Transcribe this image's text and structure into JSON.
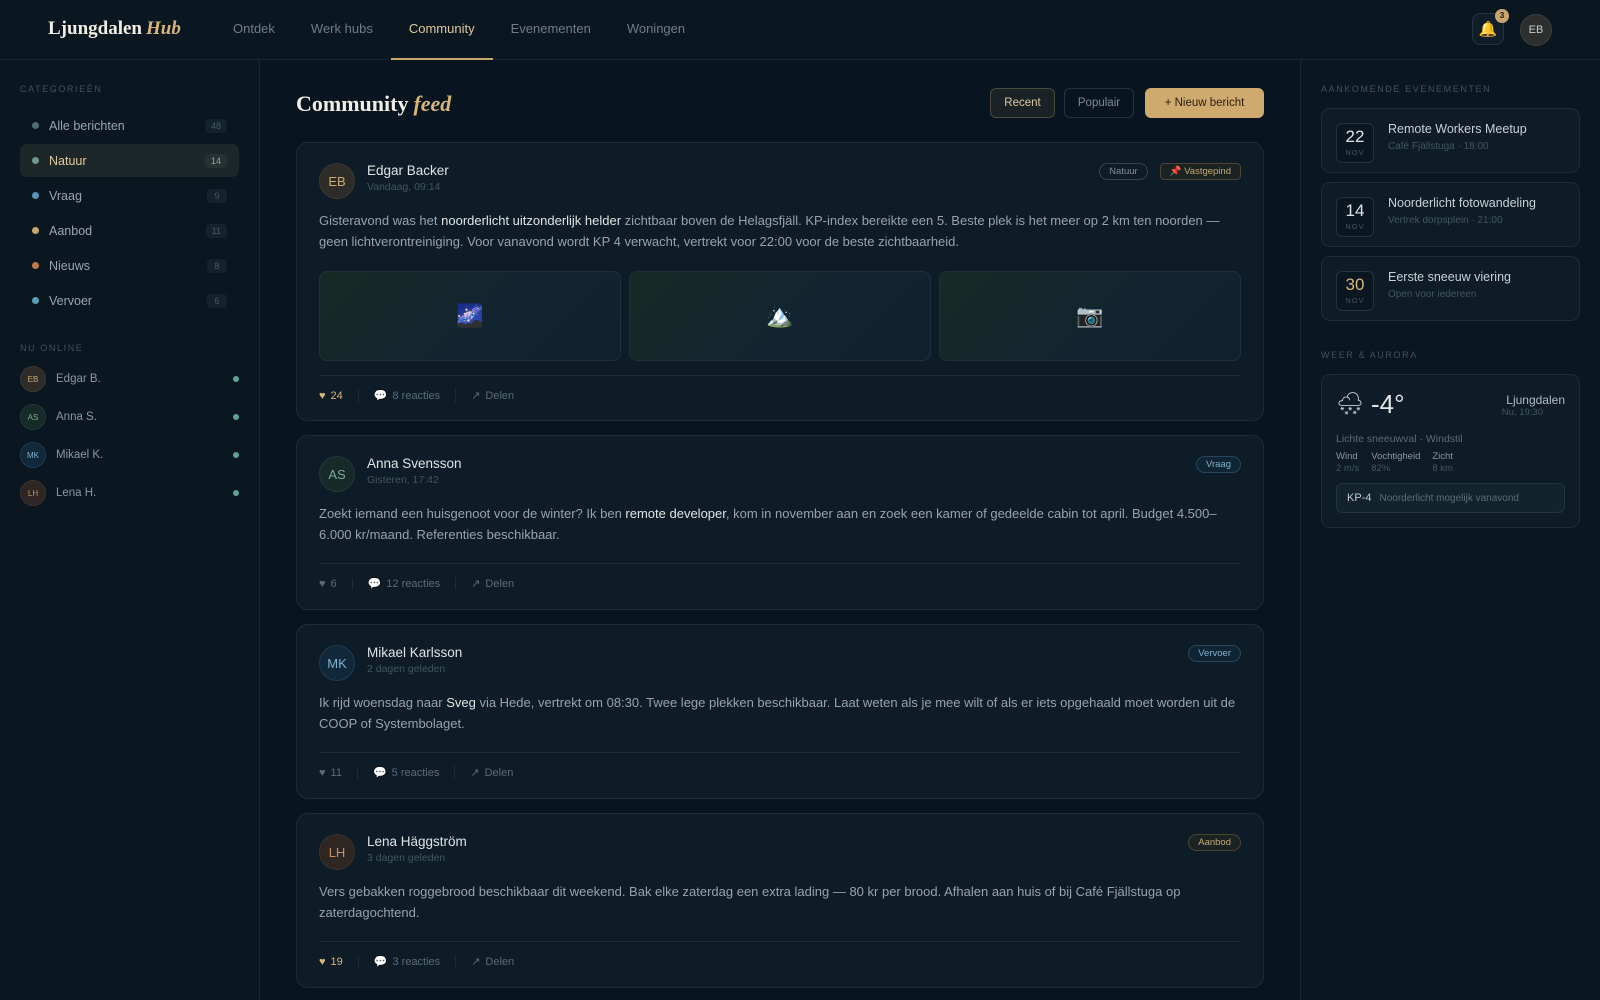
{
  "app": {
    "logo_main": "Ljungdalen",
    "logo_accent": "Hub"
  },
  "nav": [
    {
      "label": "Ontdek",
      "active": false
    },
    {
      "label": "Werk hubs",
      "active": false
    },
    {
      "label": "Community",
      "active": true
    },
    {
      "label": "Evenementen",
      "active": false
    },
    {
      "label": "Woningen",
      "active": false
    }
  ],
  "header": {
    "notification_count": "3",
    "user_initials": "EB"
  },
  "sidebar": {
    "categories_title": "CATEGORIEËN",
    "categories": [
      {
        "label": "Alle berichten",
        "count": "48",
        "color": "#4f6c72",
        "active": false
      },
      {
        "label": "Natuur",
        "count": "14",
        "color": "#6e9a8b",
        "active": true
      },
      {
        "label": "Vraag",
        "count": "9",
        "color": "#5a93b8",
        "active": false
      },
      {
        "label": "Aanbod",
        "count": "11",
        "color": "#c9a66b",
        "active": false
      },
      {
        "label": "Nieuws",
        "count": "8",
        "color": "#c07a4a",
        "active": false
      },
      {
        "label": "Vervoer",
        "count": "6",
        "color": "#5aa0b8",
        "active": false
      }
    ],
    "online_title": "NU ONLINE",
    "online": [
      {
        "initials": "EB",
        "name": "Edgar B."
      },
      {
        "initials": "AS",
        "name": "Anna S."
      },
      {
        "initials": "MK",
        "name": "Mikael K."
      },
      {
        "initials": "LH",
        "name": "Lena H."
      }
    ]
  },
  "feed": {
    "title": "Community",
    "title_accent": "feed",
    "buttons": {
      "recent": "Recent",
      "popular": "Populair",
      "new_post": "+ Nieuw bericht"
    },
    "posts": [
      {
        "initials": "EB",
        "author": "Edgar Backer",
        "time": "Vandaag, 09:14",
        "tags": [
          "Natuur"
        ],
        "pinned": "📌 Vastgepind",
        "body": [
          {
            "t": "Gisteravond was het "
          },
          {
            "t": "noorderlicht uitzonderlijk helder",
            "b": true
          },
          {
            "t": " zichtbaar boven de Helagsfjäll. KP-index bereikte een 5. Beste plek is het meer op 2 km ten noorden — geen lichtverontreiniging. Voor vanavond wordt KP 4 verwacht, vertrekt voor 22:00 voor de beste zichtbaarheid."
          }
        ],
        "images": [
          "🌌",
          "🏔️",
          "📷"
        ],
        "likes": "24",
        "comments": "8 reacties",
        "share": "Delen"
      },
      {
        "initials": "AS",
        "author": "Anna Svensson",
        "time": "Gisteren, 17:42",
        "tags": [
          "Vraag"
        ],
        "body": [
          {
            "t": "Zoekt iemand een huisgenoot voor de winter? Ik ben "
          },
          {
            "t": "remote developer",
            "b": true
          },
          {
            "t": ", kom in november aan en zoek een kamer of gedeelde cabin tot april. Budget 4.500–6.000 kr/maand. Referenties beschikbaar."
          }
        ],
        "likes": "6",
        "comments": "12 reacties",
        "share": "Delen"
      },
      {
        "initials": "MK",
        "author": "Mikael Karlsson",
        "time": "2 dagen geleden",
        "tags": [
          "Vervoer"
        ],
        "body": [
          {
            "t": "Ik rijd woensdag naar "
          },
          {
            "t": "Sveg",
            "b": true
          },
          {
            "t": " via Hede, vertrekt om 08:30. Twee lege plekken beschikbaar. Laat weten als je mee wilt of als er iets opgehaald moet worden uit de COOP of Systembolaget."
          }
        ],
        "likes": "11",
        "comments": "5 reacties",
        "share": "Delen"
      },
      {
        "initials": "LH",
        "author": "Lena Häggström",
        "time": "3 dagen geleden",
        "tags": [
          "Aanbod"
        ],
        "body": [
          {
            "t": "Vers gebakken roggebrood beschikbaar dit weekend. Bak elke zaterdag een extra lading — 80 kr per brood. Afhalen aan huis of bij Café Fjällstuga op zaterdagochtend."
          }
        ],
        "likes": "19",
        "comments": "3 reacties",
        "share": "Delen"
      }
    ]
  },
  "events": {
    "title": "AANKOMENDE EVENEMENTEN",
    "items": [
      {
        "day": "22",
        "month": "NOV",
        "name": "Remote Workers Meetup",
        "sub": "Café Fjällstuga · 18:00"
      },
      {
        "day": "14",
        "month": "NOV",
        "name": "Noorderlicht fotowandeling",
        "sub": "Vertrek dorpsplein · 21:00"
      },
      {
        "day": "30",
        "month": "NOV",
        "name": "Eerste sneeuw viering",
        "sub": "Open voor iedereen"
      }
    ]
  },
  "weather": {
    "title": "WEER & AURORA",
    "icon": "🌨",
    "temp": "-4°",
    "location": "Ljungdalen",
    "time": "Nu, 19:30",
    "description": "Lichte sneeuwval · Windstil",
    "stats": [
      {
        "label": "Wind",
        "value": "2 m/s"
      },
      {
        "label": "Vochtigheid",
        "value": "82%"
      },
      {
        "label": "Zicht",
        "value": "8 km"
      }
    ],
    "kp_label": "KP-4",
    "kp_text": "Noorderlicht mogelijk vanavond"
  },
  "colors": {
    "accent": "#c9a66b",
    "background": "#081520",
    "card": "#0d1c27"
  }
}
